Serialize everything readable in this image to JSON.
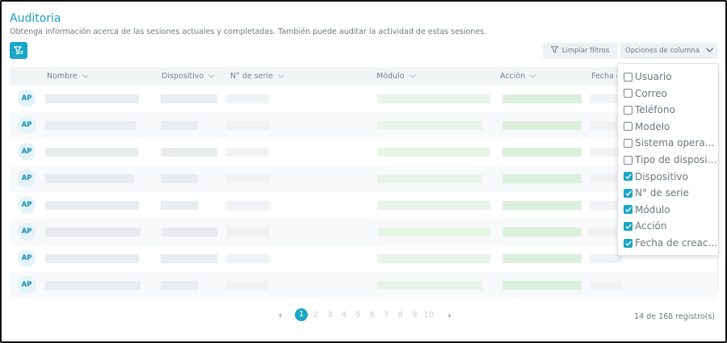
{
  "header": {
    "title": "Auditoria",
    "subtitle": "Obtenga información acerca de las sesiones actuales y completadas. También puede auditar la actividad de estas sesiones."
  },
  "toolbar": {
    "filter_icon": "filter-list-icon",
    "clear_filters_label": "Limpiar filtros",
    "column_options_label": "Opciones de columna"
  },
  "table": {
    "columns": [
      "Nombre",
      "Dispositivo",
      "N° de serie",
      "Módulo",
      "Acción",
      "Fecha d"
    ],
    "rows": [
      {
        "avatar": "AP"
      },
      {
        "avatar": "AP"
      },
      {
        "avatar": "AP"
      },
      {
        "avatar": "AP"
      },
      {
        "avatar": "AP"
      },
      {
        "avatar": "AP"
      },
      {
        "avatar": "AP"
      },
      {
        "avatar": "AP"
      }
    ]
  },
  "column_options": [
    {
      "label": "Usuario",
      "checked": false
    },
    {
      "label": "Correo",
      "checked": false
    },
    {
      "label": "Teléfono",
      "checked": false
    },
    {
      "label": "Modelo",
      "checked": false
    },
    {
      "label": "Sistema operati...",
      "checked": false
    },
    {
      "label": "Tipo de disposit...",
      "checked": false
    },
    {
      "label": "Dispositivo",
      "checked": true
    },
    {
      "label": "N° de serie",
      "checked": true
    },
    {
      "label": "Módulo",
      "checked": true
    },
    {
      "label": "Acción",
      "checked": true
    },
    {
      "label": "Fecha de creaci...",
      "checked": true
    }
  ],
  "pagination": {
    "pages": [
      "1",
      "2",
      "3",
      "4",
      "5",
      "6",
      "7",
      "8",
      "9",
      "10"
    ],
    "current": "1",
    "prev_icon": "chevron-left-icon",
    "next_icon": "chevron-right-icon",
    "count_text": "14 de 168 registro(s)"
  },
  "colors": {
    "accent": "#1aa6c6",
    "header_bg": "#f2f5f6",
    "row_alt_bg": "#f7f9fa"
  }
}
